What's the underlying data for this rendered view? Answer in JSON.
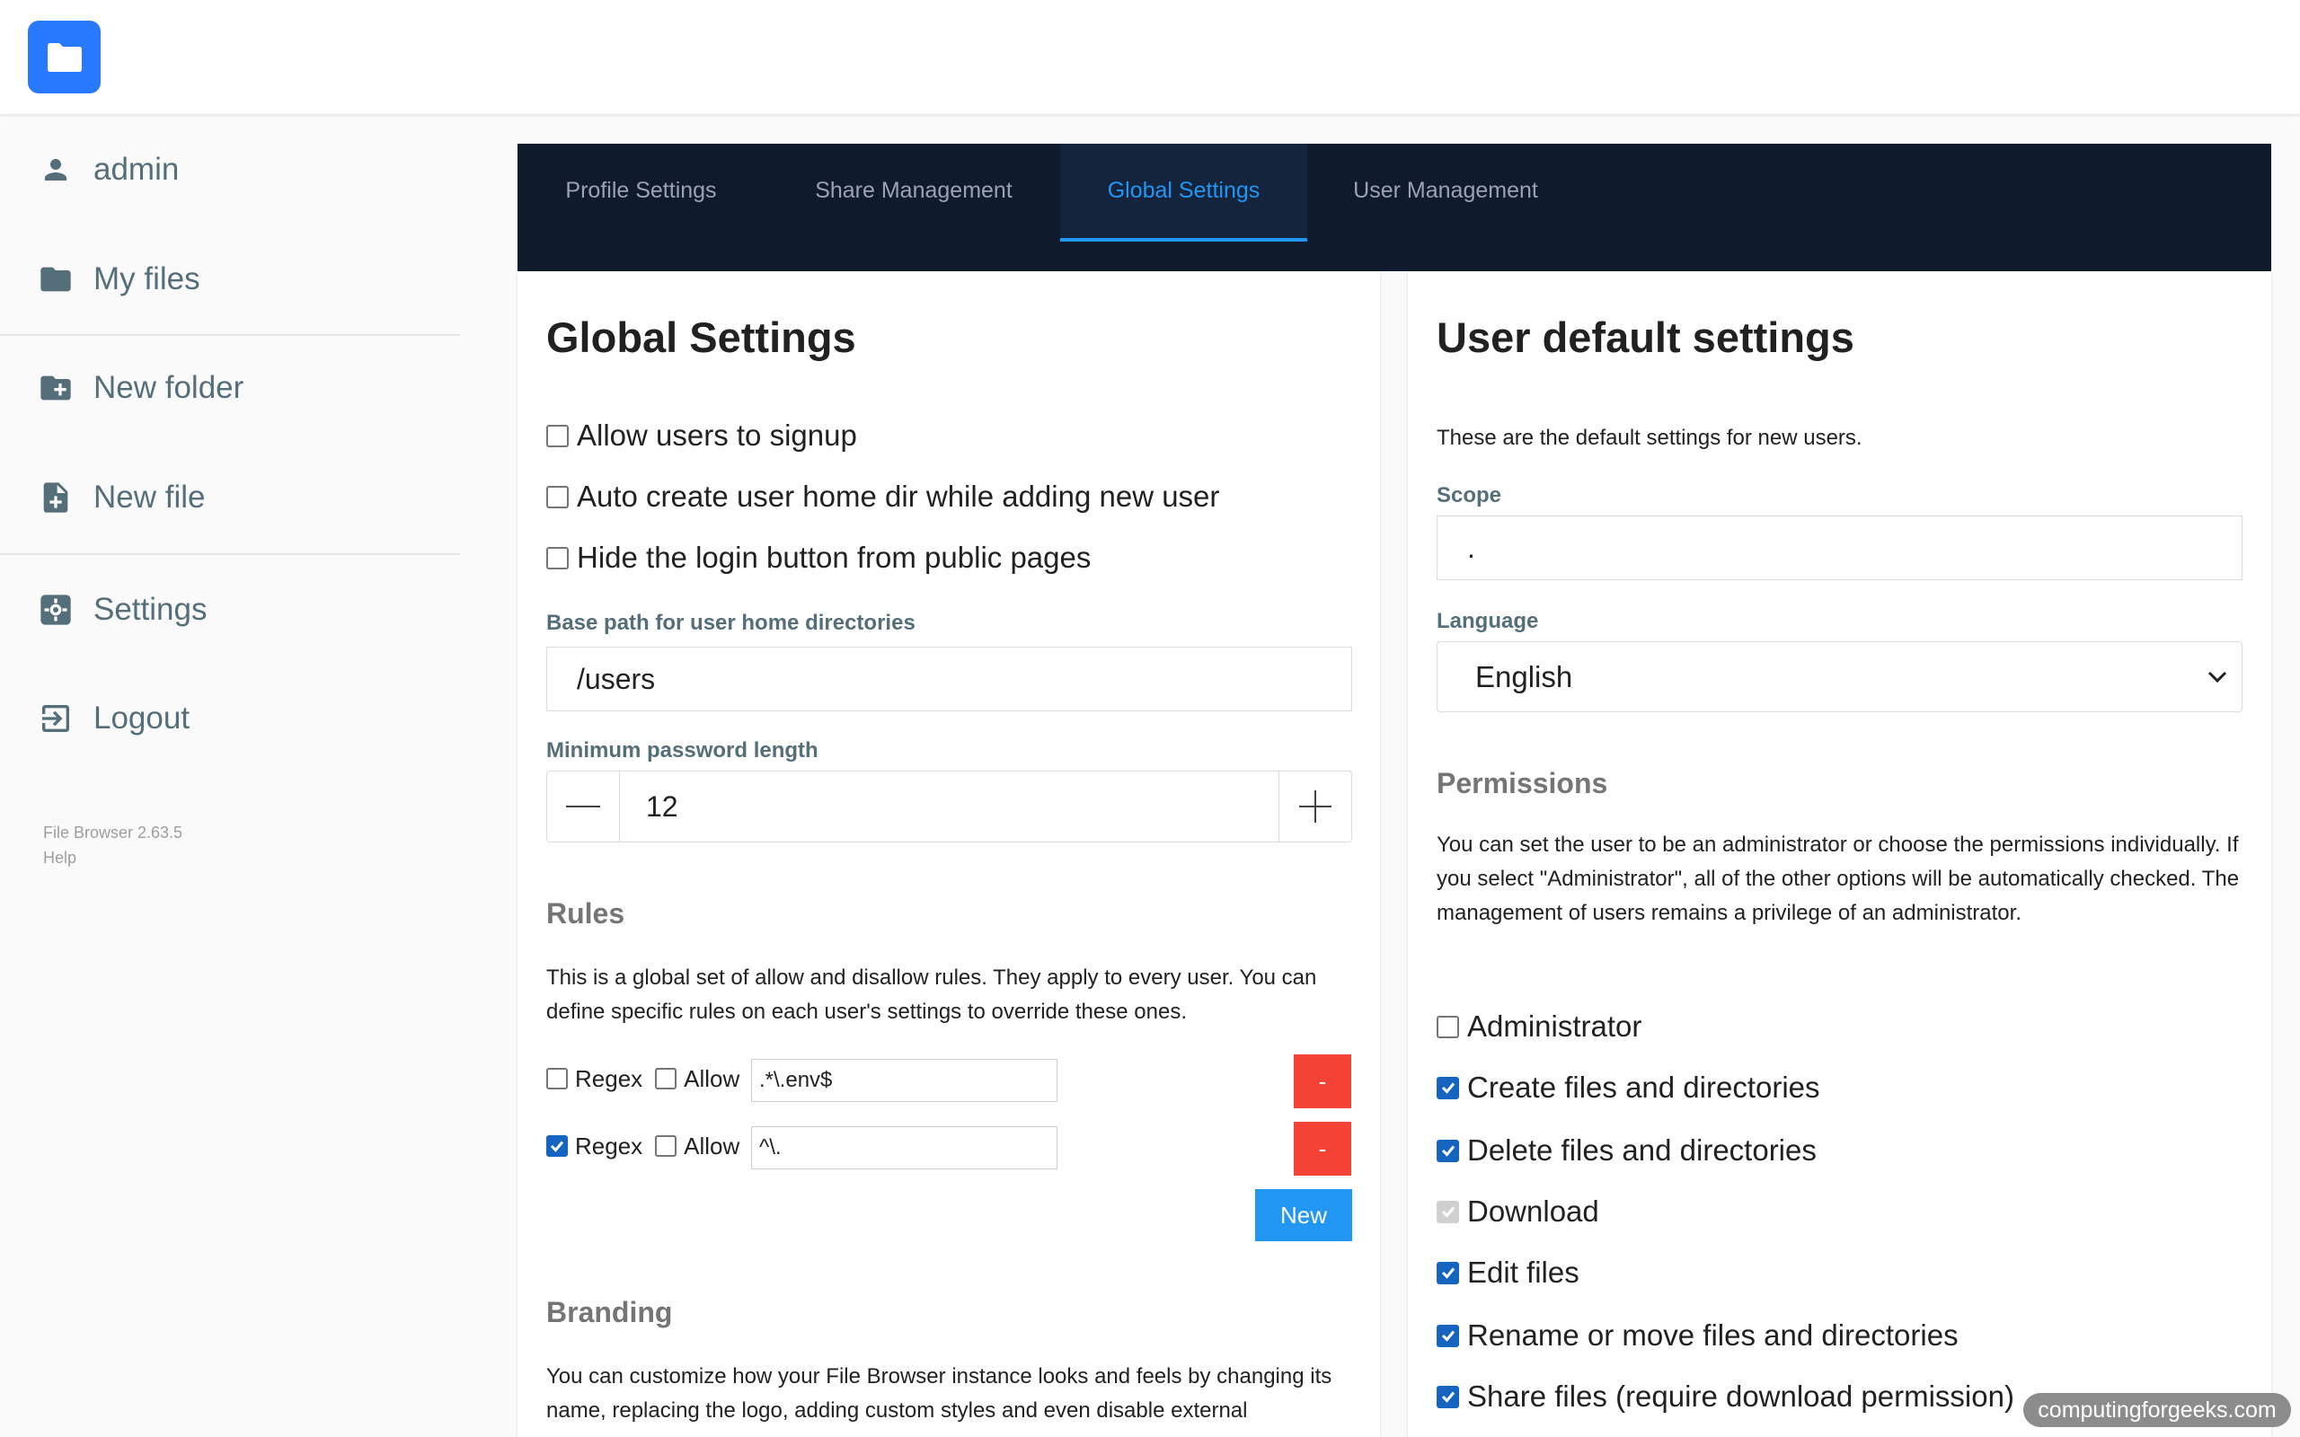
{
  "app": {
    "logo_icon": "folder-icon",
    "accent_color": "#2979ff"
  },
  "sidebar": {
    "items": [
      {
        "label": "admin",
        "icon": "person-icon"
      },
      {
        "label": "My files",
        "icon": "folder-icon"
      },
      {
        "label": "New folder",
        "icon": "folder-plus-icon"
      },
      {
        "label": "New file",
        "icon": "file-plus-icon"
      },
      {
        "label": "Settings",
        "icon": "gear-icon"
      },
      {
        "label": "Logout",
        "icon": "logout-icon"
      }
    ],
    "version": "File Browser 2.63.5",
    "help": "Help"
  },
  "tabs": [
    {
      "label": "Profile Settings",
      "active": false
    },
    {
      "label": "Share Management",
      "active": false
    },
    {
      "label": "Global Settings",
      "active": true
    },
    {
      "label": "User Management",
      "active": false
    }
  ],
  "global": {
    "title": "Global Settings",
    "options": [
      {
        "label": "Allow users to signup",
        "checked": false
      },
      {
        "label": "Auto create user home dir while adding new user",
        "checked": false
      },
      {
        "label": "Hide the login button from public pages",
        "checked": false
      }
    ],
    "base_path_label": "Base path for user home directories",
    "base_path_value": "/users",
    "min_password_label": "Minimum password length",
    "min_password_value": "12",
    "rules_title": "Rules",
    "rules_text": "This is a global set of allow and disallow rules. They apply to every user. You can define specific rules on each user's settings to override these ones.",
    "rules": [
      {
        "regex": false,
        "allow": false,
        "value": ".*\\.env$",
        "regex_label": "Regex",
        "allow_label": "Allow",
        "remove_label": "-"
      },
      {
        "regex": true,
        "allow": false,
        "value": "^\\.",
        "regex_label": "Regex",
        "allow_label": "Allow",
        "remove_label": "-"
      }
    ],
    "new_rule_label": "New",
    "branding_title": "Branding",
    "branding_text": "You can customize how your File Browser instance looks and feels by changing its name, replacing the logo, adding custom styles and even disable external"
  },
  "user_defaults": {
    "title": "User default settings",
    "description": "These are the default settings for new users.",
    "scope_label": "Scope",
    "scope_value": ".",
    "language_label": "Language",
    "language_value": "English",
    "permissions_title": "Permissions",
    "permissions_text": "You can set the user to be an administrator or choose the permissions individually. If you select \"Administrator\", all of the other options will be automatically checked. The management of users remains a privilege of an administrator.",
    "permissions": [
      {
        "label": "Administrator",
        "checked": false,
        "disabled": false
      },
      {
        "label": "Create files and directories",
        "checked": true,
        "disabled": false
      },
      {
        "label": "Delete files and directories",
        "checked": true,
        "disabled": false
      },
      {
        "label": "Download",
        "checked": true,
        "disabled": true
      },
      {
        "label": "Edit files",
        "checked": true,
        "disabled": false
      },
      {
        "label": "Rename or move files and directories",
        "checked": true,
        "disabled": false
      },
      {
        "label": "Share files (require download permission)",
        "checked": true,
        "disabled": false
      }
    ]
  },
  "watermark": "computingforgeeks.com"
}
